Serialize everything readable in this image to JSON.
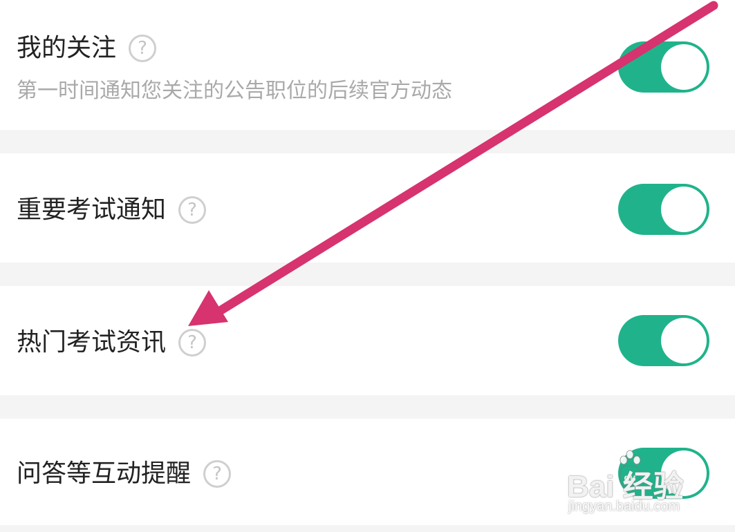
{
  "settings": [
    {
      "title": "我的关注",
      "subtitle": "第一时间通知您关注的公告职位的后续官方动态",
      "help_icon": "question-circle-icon",
      "enabled": true
    },
    {
      "title": "重要考试通知",
      "help_icon": "question-circle-icon",
      "enabled": true
    },
    {
      "title": "热门考试资讯",
      "help_icon": "question-circle-icon",
      "enabled": true
    },
    {
      "title": "问答等互动提醒",
      "help_icon": "question-circle-icon",
      "enabled": true
    }
  ],
  "help_glyph": "?",
  "annotation": {
    "type": "arrow",
    "color": "#d6336f",
    "points_to": "热门考试资讯"
  },
  "colors": {
    "toggle_on": "#20b38b",
    "background": "#f4f4f4",
    "row": "#ffffff",
    "title_text": "#222222",
    "subtitle_text": "#a9a9a9"
  },
  "watermark": {
    "brand": "Bai  经验",
    "logo_text": "du",
    "url": "jingyan.baidu.com"
  }
}
